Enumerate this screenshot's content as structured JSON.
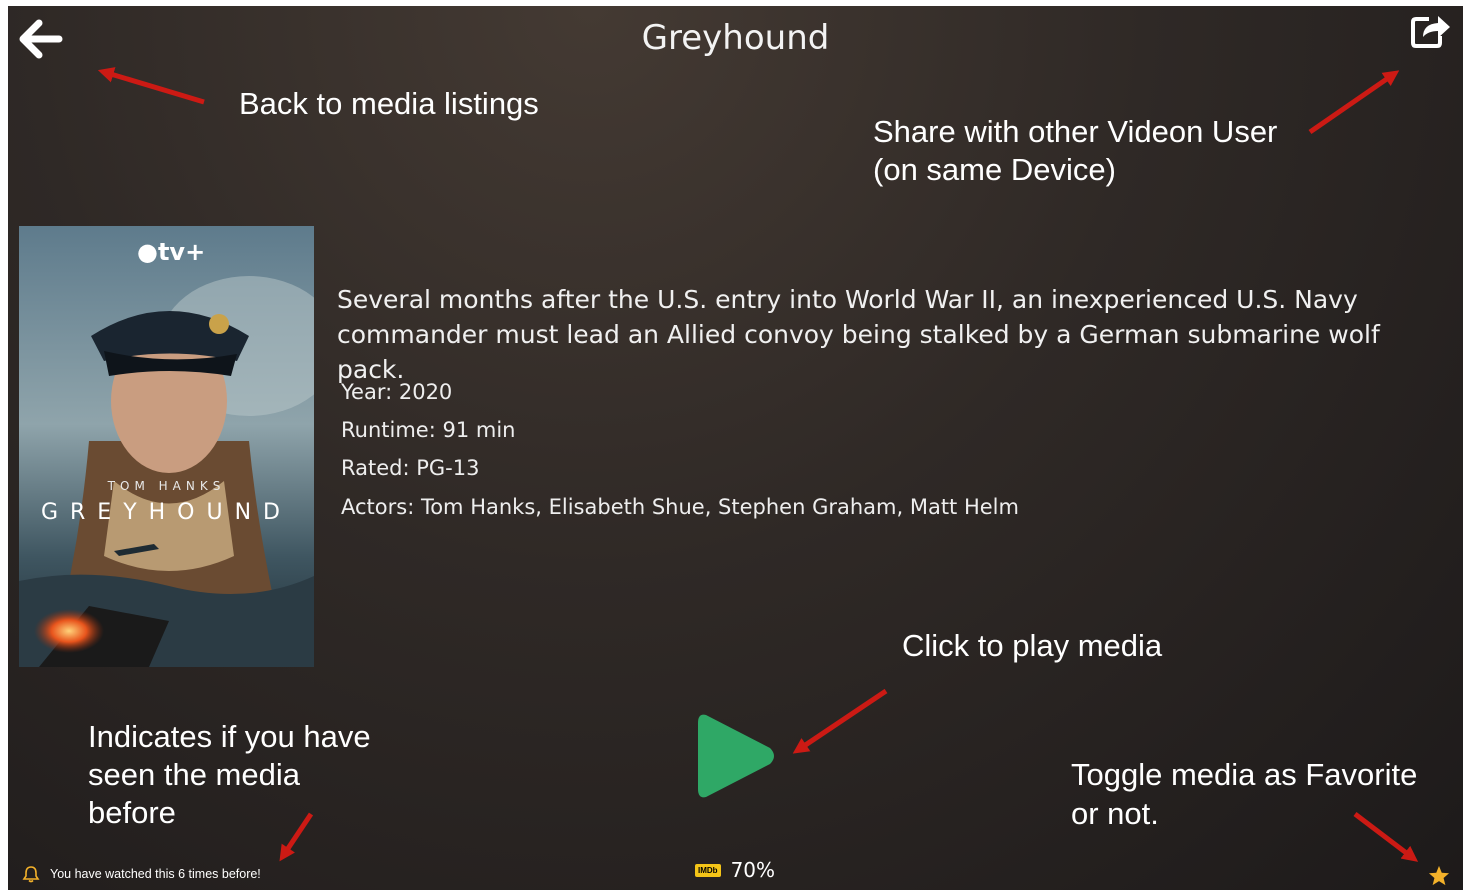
{
  "header": {
    "title": "Greyhound"
  },
  "icons": {
    "back": "arrow-left-icon",
    "share": "share-icon",
    "play": "play-icon",
    "bell": "bell-icon",
    "imdb": "imdb-icon",
    "favorite": "star-icon"
  },
  "annotations": {
    "back": "Back to media listings",
    "share_line1": "Share with other Videon User",
    "share_line2": "(on same Device)",
    "play": "Click to play media",
    "seen_line1": "Indicates if you have",
    "seen_line2": "seen the media",
    "seen_line3": "before",
    "favorite_line1": "Toggle media as Favorite",
    "favorite_line2": "or not."
  },
  "poster": {
    "brand": "tv+",
    "actor": "TOM HANKS",
    "title": "GREYHOUND"
  },
  "media": {
    "description": "Several months after the U.S. entry into World War II, an inexperienced U.S. Navy commander must lead an Allied convoy being stalked by a German submarine wolf pack.",
    "year": "Year: 2020",
    "runtime": "Runtime: 91 min",
    "rated": "Rated: PG-13",
    "actors": "Actors: Tom Hanks, Elisabeth Shue, Stephen Graham, Matt Helm"
  },
  "footer": {
    "watched": "You have watched this 6 times before!",
    "imdb_badge": "IMDb",
    "imdb_rating": "70%"
  },
  "colors": {
    "play": "#2fa866",
    "favorite": "#f3b12a",
    "annotation_arrow": "#cc1a14",
    "imdb": "#f5c518"
  }
}
